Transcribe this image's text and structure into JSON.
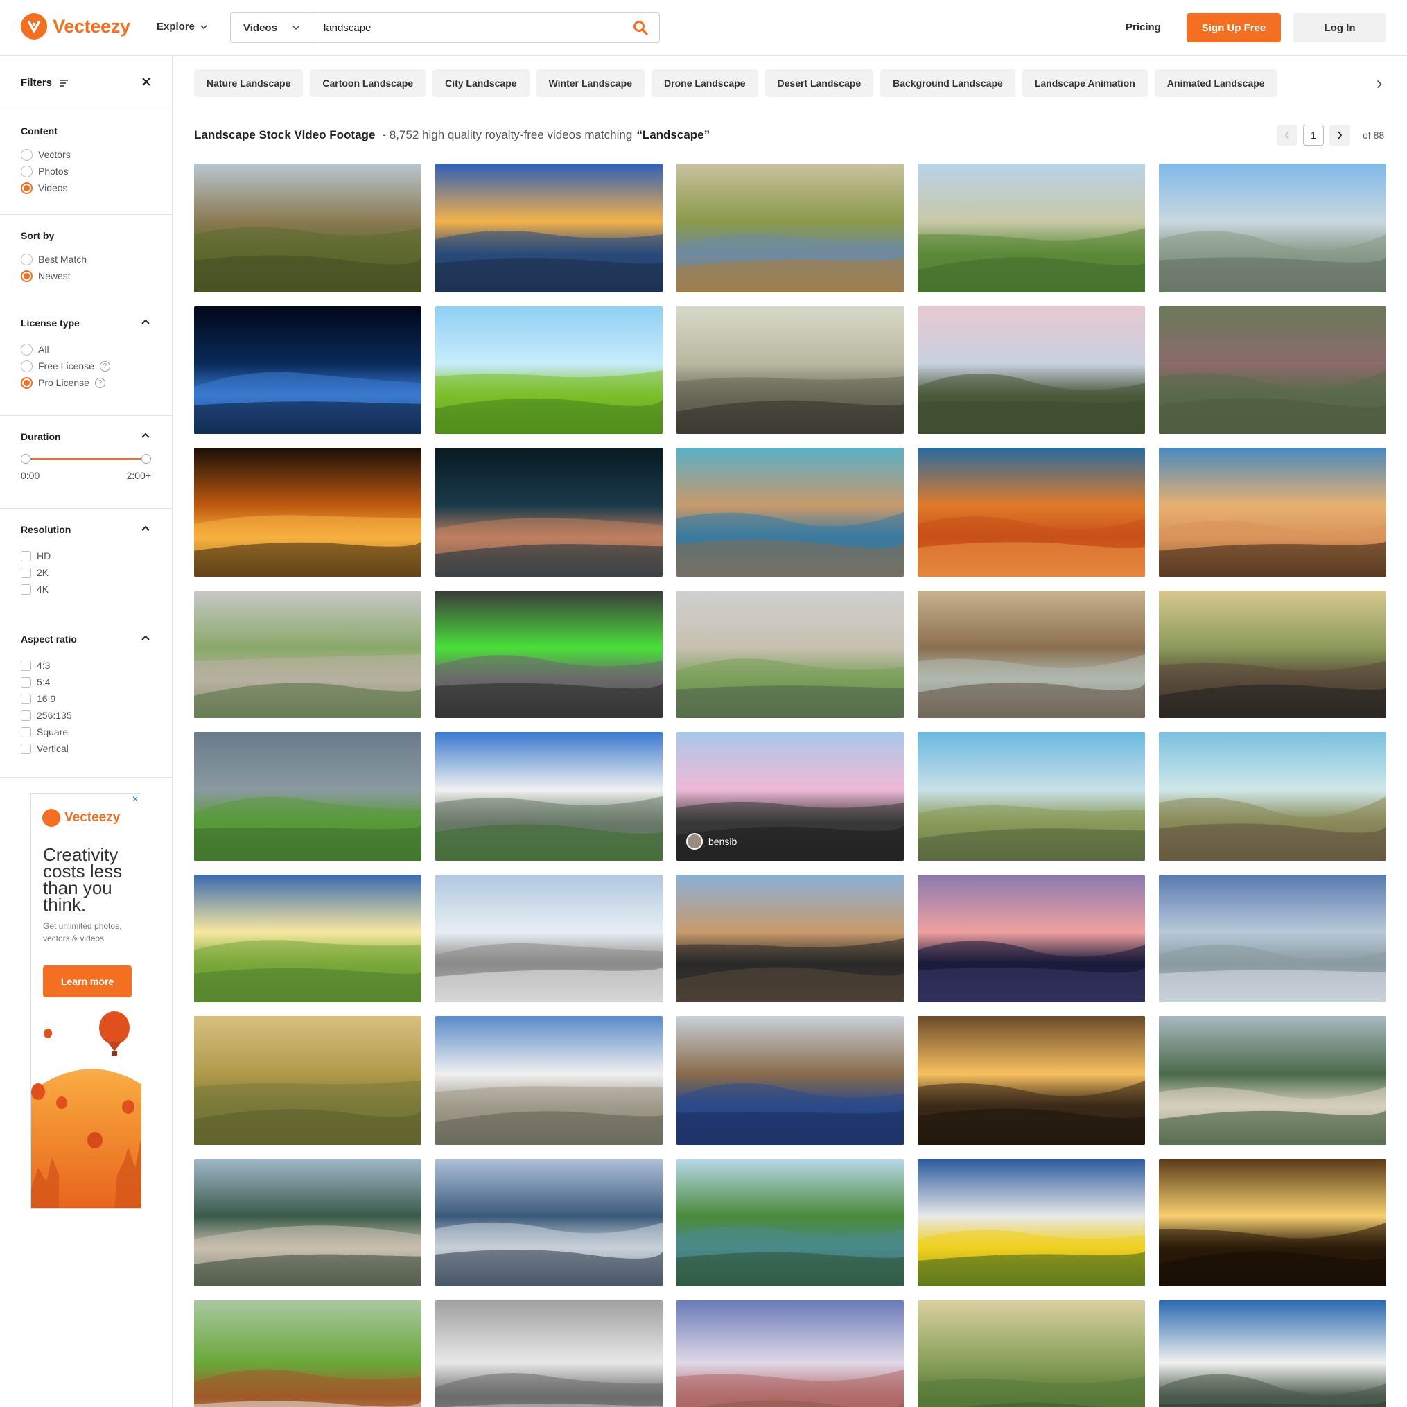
{
  "brand": {
    "name": "Vecteezy",
    "accent": "#f36f21"
  },
  "header": {
    "explore_label": "Explore",
    "search_type": "Videos",
    "search_value": "landscape",
    "pricing_label": "Pricing",
    "signup_label": "Sign Up Free",
    "login_label": "Log In"
  },
  "sidebar": {
    "filters_label": "Filters",
    "content": {
      "title": "Content",
      "options": [
        "Vectors",
        "Photos",
        "Videos"
      ],
      "selected": "Videos"
    },
    "sort": {
      "title": "Sort by",
      "options": [
        "Best Match",
        "Newest"
      ],
      "selected": "Newest"
    },
    "license": {
      "title": "License type",
      "options": [
        "All",
        "Free License",
        "Pro License"
      ],
      "selected": "Pro License"
    },
    "duration": {
      "title": "Duration",
      "min_label": "0:00",
      "max_label": "2:00+"
    },
    "resolution": {
      "title": "Resolution",
      "options": [
        "HD",
        "2K",
        "4K"
      ]
    },
    "aspect": {
      "title": "Aspect ratio",
      "options": [
        "4:3",
        "5:4",
        "16:9",
        "256:135",
        "Square",
        "Vertical"
      ]
    }
  },
  "ad": {
    "brand": "Vecteezy",
    "headline": "Creativity costs less than you think.",
    "sub": "Get unlimited photos, vectors & videos",
    "cta": "Learn more",
    "close": "✕"
  },
  "tags": [
    "Nature Landscape",
    "Cartoon Landscape",
    "City Landscape",
    "Winter Landscape",
    "Drone Landscape",
    "Desert Landscape",
    "Background Landscape",
    "Landscape Animation",
    "Animated Landscape"
  ],
  "results": {
    "heading": "Landscape Stock Video Footage",
    "summary": "- 8,752 high quality royalty-free videos matching",
    "query": "“Landscape”",
    "page": "1",
    "of_pages": "of 88"
  },
  "tiles": [
    {
      "theme": "valley-fields"
    },
    {
      "theme": "ocean-sunset"
    },
    {
      "theme": "autumn-lake"
    },
    {
      "theme": "crop-rows"
    },
    {
      "theme": "coastal-city"
    },
    {
      "theme": "blue-particles"
    },
    {
      "theme": "palm-sky"
    },
    {
      "theme": "bridge-birds"
    },
    {
      "theme": "dusk-scrubland"
    },
    {
      "theme": "aerial-field"
    },
    {
      "theme": "night-street"
    },
    {
      "theme": "pool-night"
    },
    {
      "theme": "desert-river"
    },
    {
      "theme": "orange-dune"
    },
    {
      "theme": "sand-dune"
    },
    {
      "theme": "palace-square"
    },
    {
      "theme": "green-screen-tablet"
    },
    {
      "theme": "palace-statue"
    },
    {
      "theme": "desert-pool"
    },
    {
      "theme": "forest-woman"
    },
    {
      "theme": "horses-meadow"
    },
    {
      "theme": "dolomites"
    },
    {
      "theme": "wind-turbines-pink",
      "author": "bensib"
    },
    {
      "theme": "wind-turbines-far"
    },
    {
      "theme": "wind-turbines-field"
    },
    {
      "theme": "meadow-sunset"
    },
    {
      "theme": "snow-mountain"
    },
    {
      "theme": "photographer"
    },
    {
      "theme": "refinery-dusk"
    },
    {
      "theme": "winter-pit"
    },
    {
      "theme": "golden-field"
    },
    {
      "theme": "city-skyline"
    },
    {
      "theme": "river-reflection"
    },
    {
      "theme": "dark-sunrise"
    },
    {
      "theme": "karst-river"
    },
    {
      "theme": "karst-valley"
    },
    {
      "theme": "karst-blue"
    },
    {
      "theme": "river-boats"
    },
    {
      "theme": "tulips"
    },
    {
      "theme": "dark-sunrise-2"
    },
    {
      "theme": "cows"
    },
    {
      "theme": "bw-mountain"
    },
    {
      "theme": "purple-hills"
    },
    {
      "theme": "misty-green"
    },
    {
      "theme": "snowy-hills"
    }
  ]
}
